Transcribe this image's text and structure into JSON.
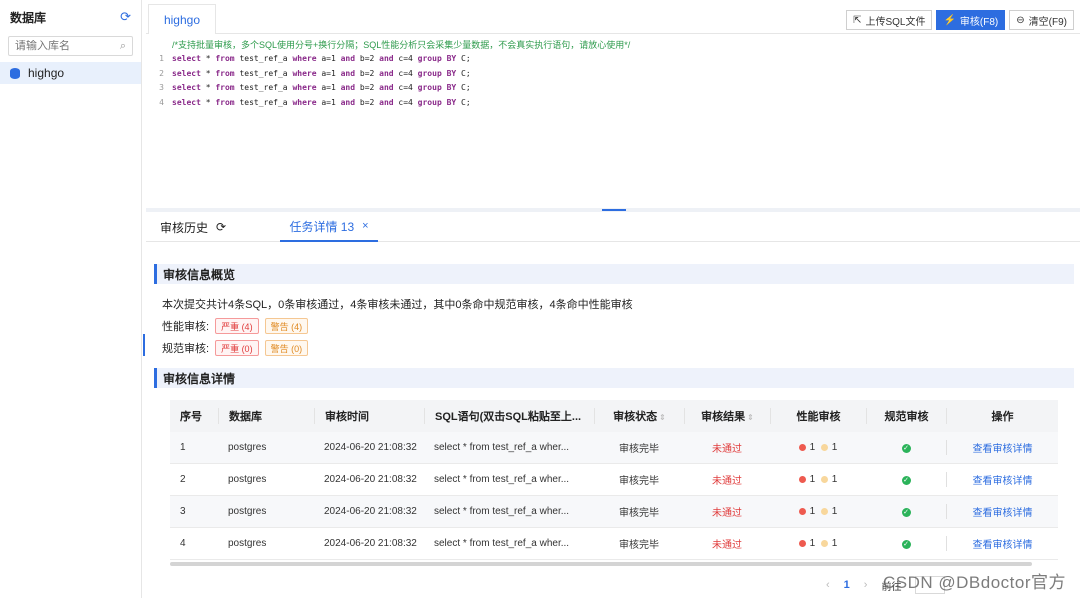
{
  "sidebar": {
    "title": "数据库",
    "search_placeholder": "请输入库名",
    "items": [
      {
        "label": "highgo"
      }
    ]
  },
  "editor": {
    "tab_label": "highgo",
    "toolbar": {
      "upload_label": "上传SQL文件",
      "audit_label": "审核(F8)",
      "clear_label": "清空(F9)"
    },
    "comment": "/*支持批量审核，多个SQL使用分号+换行分隔；SQL性能分析只会采集少量数据，不会真实执行语句，请放心使用*/",
    "lines": [
      {
        "no": "1",
        "text": "select * from test_ref_a where a=1 and b=2 and c=4 group BY C;"
      },
      {
        "no": "2",
        "text": "select * from test_ref_a where a=1 and b=2 and c=4 group BY C;"
      },
      {
        "no": "3",
        "text": "select * from test_ref_a where a=1 and b=2 and c=4 group BY C;"
      },
      {
        "no": "4",
        "text": "select * from test_ref_a where a=1 and b=2 and c=4 group BY C;"
      }
    ]
  },
  "lower": {
    "tab_history": "审核历史",
    "tab_detail": "任务详情 13",
    "overview_title": "审核信息概览",
    "summary": "本次提交共计4条SQL，0条审核通过，4条审核未通过，其中0条命中规范审核，4条命中性能审核",
    "perf_label": "性能审核:",
    "perf_severe": "严重 (4)",
    "perf_warn": "警告 (4)",
    "spec_label": "规范审核:",
    "spec_severe": "严重 (0)",
    "spec_warn": "警告 (0)",
    "detail_title": "审核信息详情"
  },
  "table": {
    "headers": {
      "no": "序号",
      "db": "数据库",
      "time": "审核时间",
      "sql": "SQL语句(双击SQL粘贴至上...",
      "status": "审核状态",
      "result": "审核结果",
      "perf": "性能审核",
      "spec": "规范审核",
      "op": "操作"
    },
    "rows": [
      {
        "no": "1",
        "db": "postgres",
        "time": "2024-06-20 21:08:32",
        "sql": "select * from test_ref_a wher...",
        "status": "审核完毕",
        "result": "未通过",
        "perf_red": "1",
        "perf_orange": "1",
        "op": "查看审核详情"
      },
      {
        "no": "2",
        "db": "postgres",
        "time": "2024-06-20 21:08:32",
        "sql": "select * from test_ref_a wher...",
        "status": "审核完毕",
        "result": "未通过",
        "perf_red": "1",
        "perf_orange": "1",
        "op": "查看审核详情"
      },
      {
        "no": "3",
        "db": "postgres",
        "time": "2024-06-20 21:08:32",
        "sql": "select * from test_ref_a wher...",
        "status": "审核完毕",
        "result": "未通过",
        "perf_red": "1",
        "perf_orange": "1",
        "op": "查看审核详情"
      },
      {
        "no": "4",
        "db": "postgres",
        "time": "2024-06-20 21:08:32",
        "sql": "select * from test_ref_a wher...",
        "status": "审核完毕",
        "result": "未通过",
        "perf_red": "1",
        "perf_orange": "1",
        "op": "查看审核详情"
      }
    ]
  },
  "pager": {
    "current": "1",
    "goto": "前往"
  },
  "watermark": "CSDN @DBdoctor官方",
  "colors": {
    "accent": "#2d6de0",
    "danger": "#e03c3c",
    "warning": "#e08a22",
    "success": "#2bb35a"
  }
}
